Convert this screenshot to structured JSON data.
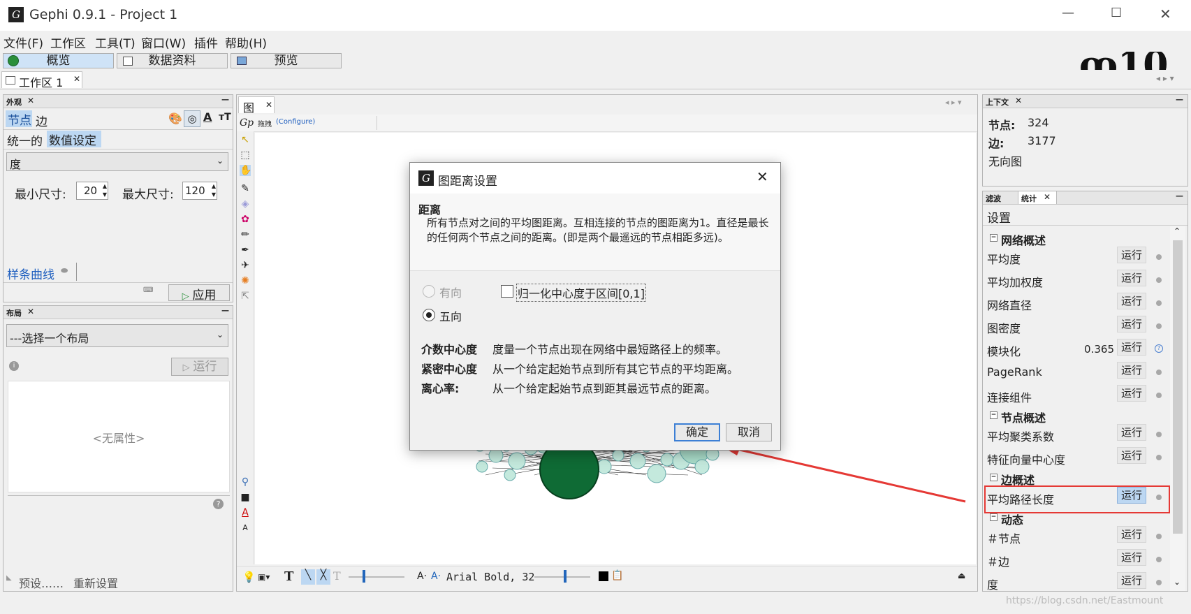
{
  "window": {
    "title": "Gephi 0.9.1 - Project 1",
    "logo_text": "G",
    "min": "—",
    "max": "☐",
    "close": "✕"
  },
  "menu": [
    "文件(F)",
    "工作区",
    "工具(T)",
    "窗口(W)",
    "插件",
    "帮助(H)"
  ],
  "modes": [
    "概览",
    "数据资料",
    "预览"
  ],
  "workspace_tab": {
    "label": "工作区 1",
    "close": "✕"
  },
  "appearance": {
    "title": "外观",
    "close": "✕",
    "tabs": [
      "节点",
      "边"
    ],
    "subtabs": [
      "统一的",
      "数值设定"
    ],
    "attribute": "度",
    "min_label": "最小尺寸:",
    "min_value": "20",
    "max_label": "最大尺寸:",
    "max_value": "120",
    "spline": "样条曲线",
    "apply": "应用"
  },
  "layout": {
    "title": "布局",
    "close": "✕",
    "select": "---选择一个布局",
    "run": "运行",
    "no_props": "<无属性>",
    "presets": "预设……",
    "reset": "重新设置"
  },
  "graph": {
    "tab": "图",
    "close": "✕",
    "tool": "拖拽",
    "configure": "(Configure)",
    "font": "Arial Bold, 32"
  },
  "context": {
    "title": "上下文",
    "close": "✕",
    "nodes_label": "节点:",
    "nodes": "324",
    "edges_label": "边:",
    "edges": "3177",
    "type": "无向图"
  },
  "stats": {
    "tab_filter": "滤波",
    "tab_stats": "统计",
    "close": "✕",
    "settings": "设置",
    "run_label": "运行",
    "sections": [
      {
        "title": "网络概述",
        "items": [
          {
            "label": "平均度",
            "value": ""
          },
          {
            "label": "平均加权度",
            "value": ""
          },
          {
            "label": "网络直径",
            "value": ""
          },
          {
            "label": "图密度",
            "value": ""
          },
          {
            "label": "模块化",
            "value": "0.365"
          },
          {
            "label": "PageRank",
            "value": ""
          },
          {
            "label": "连接组件",
            "value": ""
          }
        ]
      },
      {
        "title": "节点概述",
        "items": [
          {
            "label": "平均聚类系数",
            "value": ""
          },
          {
            "label": "特征向量中心度",
            "value": ""
          }
        ]
      },
      {
        "title": "边概述",
        "items": [
          {
            "label": "平均路径长度",
            "value": ""
          }
        ]
      },
      {
        "title": "动态",
        "items": [
          {
            "label": "＃节点",
            "value": ""
          },
          {
            "label": "＃边",
            "value": ""
          },
          {
            "label": "度",
            "value": ""
          }
        ]
      }
    ]
  },
  "dialog": {
    "title": "图距离设置",
    "heading": "距离",
    "desc": "所有节点对之间的平均图距离。互相连接的节点的图距离为1。直径是最长的任何两个节点之间的距离。(即是两个最遥远的节点相距多远)。",
    "directed": "有向",
    "undirected": "五向",
    "normalize": "归一化中心度于区间[0,1]",
    "defs": [
      {
        "term": "介数中心度",
        "text": "度量一个节点出现在网络中最短路径上的频率。"
      },
      {
        "term": "紧密中心度",
        "text": "从一个给定起始节点到所有其它节点的平均距离。"
      },
      {
        "term": "离心率:",
        "text": "从一个给定起始节点到距其最远节点的距离。"
      }
    ],
    "ok": "确定",
    "cancel": "取消"
  },
  "watermark": "https://blog.csdn.net/Eastmount",
  "colors": {
    "highlight": "#e53935",
    "selected_bg": "#bcd7f2",
    "node_dark": "#0f6b35",
    "node_light": "#a9dcc9"
  }
}
